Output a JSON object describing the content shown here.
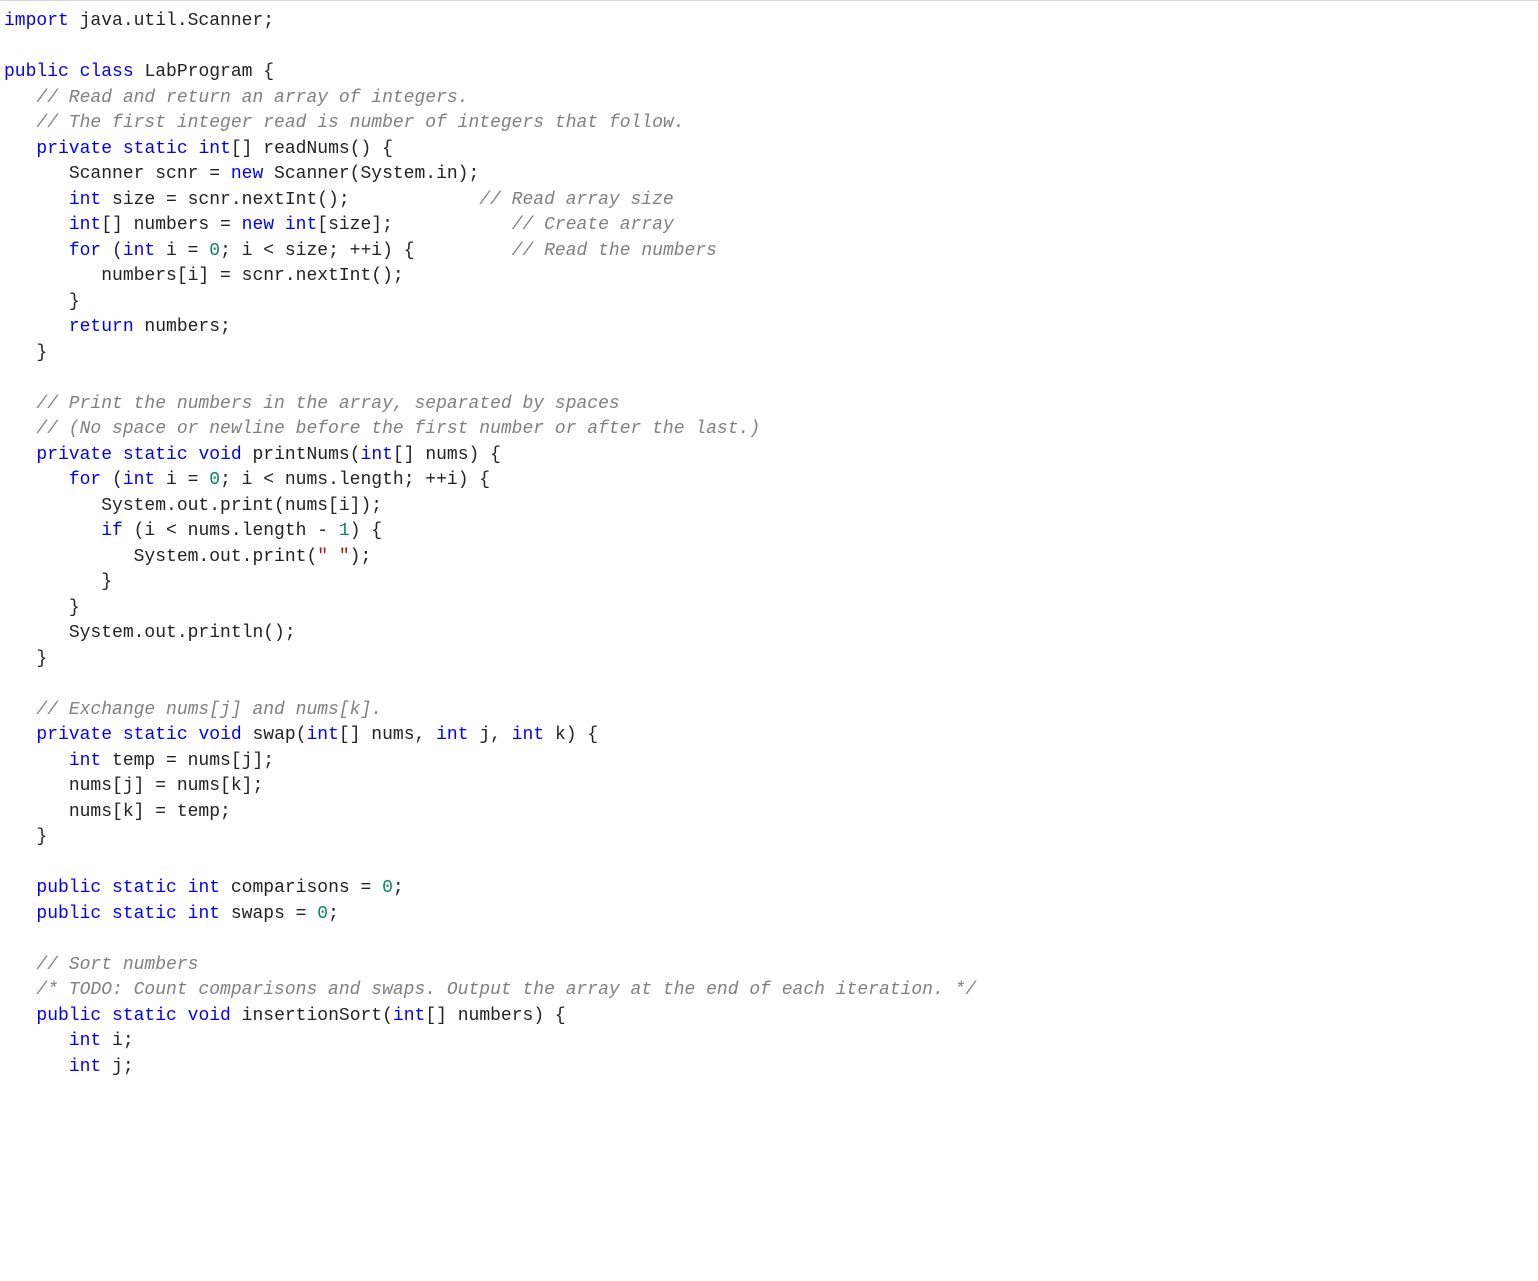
{
  "code": {
    "colors": {
      "keyword": "#0000ff",
      "comment_italic": "#808080",
      "number": "#098658",
      "string": "#a31515",
      "default": "#222222",
      "background": "#ffffff",
      "top_border": "#d8d8d8"
    },
    "font_family": "Consolas",
    "lines": [
      {
        "indent": 0,
        "tokens": [
          {
            "t": "kw",
            "v": "import"
          },
          {
            "t": "tx",
            "v": " java.util.Scanner;"
          }
        ]
      },
      {
        "indent": 0,
        "tokens": []
      },
      {
        "indent": 0,
        "tokens": [
          {
            "t": "kw",
            "v": "public"
          },
          {
            "t": "tx",
            "v": " "
          },
          {
            "t": "kw",
            "v": "class"
          },
          {
            "t": "tx",
            "v": " LabProgram {"
          }
        ]
      },
      {
        "indent": 1,
        "tokens": [
          {
            "t": "cm",
            "v": "// Read and return an array of integers."
          }
        ]
      },
      {
        "indent": 1,
        "tokens": [
          {
            "t": "cm",
            "v": "// The first integer read is number of integers that follow."
          }
        ]
      },
      {
        "indent": 1,
        "tokens": [
          {
            "t": "kw",
            "v": "private"
          },
          {
            "t": "tx",
            "v": " "
          },
          {
            "t": "kw",
            "v": "static"
          },
          {
            "t": "tx",
            "v": " "
          },
          {
            "t": "kw",
            "v": "int"
          },
          {
            "t": "tx",
            "v": "[] readNums() {"
          }
        ]
      },
      {
        "indent": 2,
        "tokens": [
          {
            "t": "tx",
            "v": "Scanner scnr = "
          },
          {
            "t": "kw",
            "v": "new"
          },
          {
            "t": "tx",
            "v": " Scanner(System.in);"
          }
        ]
      },
      {
        "indent": 2,
        "tokens": [
          {
            "t": "kw",
            "v": "int"
          },
          {
            "t": "tx",
            "v": " size = scnr.nextInt();            "
          },
          {
            "t": "cm",
            "v": "// Read array size"
          }
        ]
      },
      {
        "indent": 2,
        "tokens": [
          {
            "t": "kw",
            "v": "int"
          },
          {
            "t": "tx",
            "v": "[] numbers = "
          },
          {
            "t": "kw",
            "v": "new"
          },
          {
            "t": "tx",
            "v": " "
          },
          {
            "t": "kw",
            "v": "int"
          },
          {
            "t": "tx",
            "v": "[size];           "
          },
          {
            "t": "cm",
            "v": "// Create array"
          }
        ]
      },
      {
        "indent": 2,
        "tokens": [
          {
            "t": "kw",
            "v": "for"
          },
          {
            "t": "tx",
            "v": " ("
          },
          {
            "t": "kw",
            "v": "int"
          },
          {
            "t": "tx",
            "v": " i = "
          },
          {
            "t": "num",
            "v": "0"
          },
          {
            "t": "tx",
            "v": "; i < size; ++i) {         "
          },
          {
            "t": "cm",
            "v": "// Read the numbers"
          }
        ]
      },
      {
        "indent": 3,
        "tokens": [
          {
            "t": "tx",
            "v": "numbers[i] = scnr.nextInt();"
          }
        ]
      },
      {
        "indent": 2,
        "tokens": [
          {
            "t": "tx",
            "v": "}"
          }
        ]
      },
      {
        "indent": 2,
        "tokens": [
          {
            "t": "kw",
            "v": "return"
          },
          {
            "t": "tx",
            "v": " numbers;"
          }
        ]
      },
      {
        "indent": 1,
        "tokens": [
          {
            "t": "tx",
            "v": "}"
          }
        ]
      },
      {
        "indent": 0,
        "tokens": []
      },
      {
        "indent": 1,
        "tokens": [
          {
            "t": "cm",
            "v": "// Print the numbers in the array, separated by spaces"
          }
        ]
      },
      {
        "indent": 1,
        "tokens": [
          {
            "t": "cm",
            "v": "// (No space or newline before the first number or after the last.)"
          }
        ]
      },
      {
        "indent": 1,
        "tokens": [
          {
            "t": "kw",
            "v": "private"
          },
          {
            "t": "tx",
            "v": " "
          },
          {
            "t": "kw",
            "v": "static"
          },
          {
            "t": "tx",
            "v": " "
          },
          {
            "t": "kw",
            "v": "void"
          },
          {
            "t": "tx",
            "v": " printNums("
          },
          {
            "t": "kw",
            "v": "int"
          },
          {
            "t": "tx",
            "v": "[] nums) {"
          }
        ]
      },
      {
        "indent": 2,
        "tokens": [
          {
            "t": "kw",
            "v": "for"
          },
          {
            "t": "tx",
            "v": " ("
          },
          {
            "t": "kw",
            "v": "int"
          },
          {
            "t": "tx",
            "v": " i = "
          },
          {
            "t": "num",
            "v": "0"
          },
          {
            "t": "tx",
            "v": "; i < nums.length; ++i) {"
          }
        ]
      },
      {
        "indent": 3,
        "tokens": [
          {
            "t": "tx",
            "v": "System.out.print(nums[i]);"
          }
        ]
      },
      {
        "indent": 3,
        "tokens": [
          {
            "t": "kw",
            "v": "if"
          },
          {
            "t": "tx",
            "v": " (i < nums.length - "
          },
          {
            "t": "num",
            "v": "1"
          },
          {
            "t": "tx",
            "v": ") {"
          }
        ]
      },
      {
        "indent": 4,
        "tokens": [
          {
            "t": "tx",
            "v": "System.out.print("
          },
          {
            "t": "str",
            "v": "\" \""
          },
          {
            "t": "tx",
            "v": ");"
          }
        ]
      },
      {
        "indent": 3,
        "tokens": [
          {
            "t": "tx",
            "v": "}"
          }
        ]
      },
      {
        "indent": 2,
        "tokens": [
          {
            "t": "tx",
            "v": "}"
          }
        ]
      },
      {
        "indent": 2,
        "tokens": [
          {
            "t": "tx",
            "v": "System.out.println();"
          }
        ]
      },
      {
        "indent": 1,
        "tokens": [
          {
            "t": "tx",
            "v": "}"
          }
        ]
      },
      {
        "indent": 0,
        "tokens": []
      },
      {
        "indent": 1,
        "tokens": [
          {
            "t": "cm",
            "v": "// Exchange nums[j] and nums[k]."
          }
        ]
      },
      {
        "indent": 1,
        "tokens": [
          {
            "t": "kw",
            "v": "private"
          },
          {
            "t": "tx",
            "v": " "
          },
          {
            "t": "kw",
            "v": "static"
          },
          {
            "t": "tx",
            "v": " "
          },
          {
            "t": "kw",
            "v": "void"
          },
          {
            "t": "tx",
            "v": " swap("
          },
          {
            "t": "kw",
            "v": "int"
          },
          {
            "t": "tx",
            "v": "[] nums, "
          },
          {
            "t": "kw",
            "v": "int"
          },
          {
            "t": "tx",
            "v": " j, "
          },
          {
            "t": "kw",
            "v": "int"
          },
          {
            "t": "tx",
            "v": " k) {"
          }
        ]
      },
      {
        "indent": 2,
        "tokens": [
          {
            "t": "kw",
            "v": "int"
          },
          {
            "t": "tx",
            "v": " temp = nums[j];"
          }
        ]
      },
      {
        "indent": 2,
        "tokens": [
          {
            "t": "tx",
            "v": "nums[j] = nums[k];"
          }
        ]
      },
      {
        "indent": 2,
        "tokens": [
          {
            "t": "tx",
            "v": "nums[k] = temp;"
          }
        ]
      },
      {
        "indent": 1,
        "tokens": [
          {
            "t": "tx",
            "v": "}"
          }
        ]
      },
      {
        "indent": 0,
        "tokens": []
      },
      {
        "indent": 1,
        "tokens": [
          {
            "t": "kw",
            "v": "public"
          },
          {
            "t": "tx",
            "v": " "
          },
          {
            "t": "kw",
            "v": "static"
          },
          {
            "t": "tx",
            "v": " "
          },
          {
            "t": "kw",
            "v": "int"
          },
          {
            "t": "tx",
            "v": " comparisons = "
          },
          {
            "t": "num",
            "v": "0"
          },
          {
            "t": "tx",
            "v": ";"
          }
        ]
      },
      {
        "indent": 1,
        "tokens": [
          {
            "t": "kw",
            "v": "public"
          },
          {
            "t": "tx",
            "v": " "
          },
          {
            "t": "kw",
            "v": "static"
          },
          {
            "t": "tx",
            "v": " "
          },
          {
            "t": "kw",
            "v": "int"
          },
          {
            "t": "tx",
            "v": " swaps = "
          },
          {
            "t": "num",
            "v": "0"
          },
          {
            "t": "tx",
            "v": ";"
          }
        ]
      },
      {
        "indent": 0,
        "tokens": []
      },
      {
        "indent": 1,
        "tokens": [
          {
            "t": "cm",
            "v": "// Sort numbers"
          }
        ]
      },
      {
        "indent": 1,
        "tokens": [
          {
            "t": "cm",
            "v": "/* TODO: Count comparisons and swaps. Output the array at the end of each iteration. */"
          }
        ]
      },
      {
        "indent": 1,
        "tokens": [
          {
            "t": "kw",
            "v": "public"
          },
          {
            "t": "tx",
            "v": " "
          },
          {
            "t": "kw",
            "v": "static"
          },
          {
            "t": "tx",
            "v": " "
          },
          {
            "t": "kw",
            "v": "void"
          },
          {
            "t": "tx",
            "v": " insertionSort("
          },
          {
            "t": "kw",
            "v": "int"
          },
          {
            "t": "tx",
            "v": "[] numbers) {"
          }
        ]
      },
      {
        "indent": 2,
        "tokens": [
          {
            "t": "kw",
            "v": "int"
          },
          {
            "t": "tx",
            "v": " i;"
          }
        ]
      },
      {
        "indent": 2,
        "tokens": [
          {
            "t": "kw",
            "v": "int"
          },
          {
            "t": "tx",
            "v": " j;"
          }
        ]
      }
    ],
    "indent_unit": "   "
  }
}
